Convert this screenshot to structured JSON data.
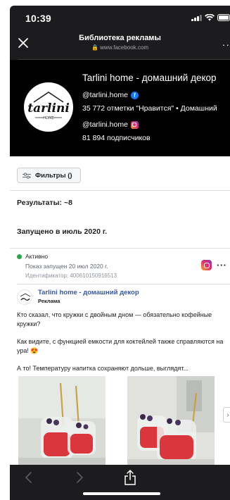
{
  "status_bar": {
    "time": "10:39"
  },
  "nav": {
    "title": "Библиотека рекламы",
    "url": "www.facebook.com",
    "close_icon": "close-icon",
    "more_icon": "more-icon"
  },
  "page_header": {
    "logo_text": "tarlini",
    "logo_subtext": "HOME",
    "name": "Tarlini home - домашний декор",
    "facebook_handle": "@tarlini.home",
    "likes": "35 772 отметки \"Нравится\" • Домашний",
    "instagram_handle": "@tarlini.home",
    "followers": "81 894 подписчиков"
  },
  "filters": {
    "label": "Фильтры ()"
  },
  "results": {
    "label": "Результаты: ~8"
  },
  "group": {
    "label": "Запущено в июль 2020 г."
  },
  "ad": {
    "status": "Активно",
    "started": "Показ запущен 20 июл 2020 г.",
    "id": "Идентификатор: 400610150916513",
    "advertiser": "Tarlini home - домашний декор",
    "sponsored": "Реклама",
    "text_1": "Кто сказал, что кружки с двойным дном — обязательно кофейные кружки?",
    "text_2": "Как видите, с функцией емкости для коктейлей также справляются на ура! 😍",
    "text_3": "А то! Температуру напитка сохраняют дольше, выглядят...",
    "carousel_next": "›"
  },
  "colors": {
    "dark": "#1c1c1e",
    "link": "#385898",
    "active": "#31a24c"
  }
}
